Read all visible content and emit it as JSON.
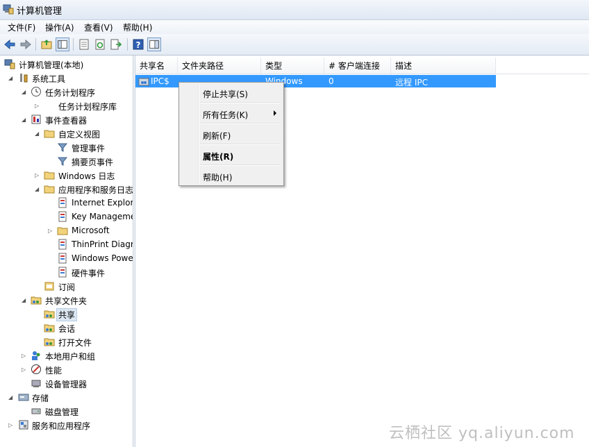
{
  "window": {
    "title": "计算机管理"
  },
  "menu": [
    "文件(F)",
    "操作(A)",
    "查看(V)",
    "帮助(H)"
  ],
  "toolbar": {
    "buttons": [
      "back-icon",
      "forward-icon",
      "up-folder-icon",
      "show-hide-console-tree-icon",
      "properties-icon",
      "refresh-icon",
      "export-list-icon",
      "help-icon",
      "show-hide-action-pane-icon"
    ]
  },
  "tree": {
    "nodes": [
      {
        "label": "计算机管理(本地)",
        "icon": "computer-management-icon"
      },
      {
        "label": "系统工具",
        "icon": "tools-icon"
      },
      {
        "label": "任务计划程序",
        "icon": "clock-icon"
      },
      {
        "label": "任务计划程序库",
        "icon": ""
      },
      {
        "label": "事件查看器",
        "icon": "event-viewer-icon"
      },
      {
        "label": "自定义视图",
        "icon": "folder-icon"
      },
      {
        "label": "管理事件",
        "icon": "filter-icon"
      },
      {
        "label": "摘要页事件",
        "icon": "filter-icon"
      },
      {
        "label": "Windows 日志",
        "icon": "folder-icon"
      },
      {
        "label": "应用程序和服务日志",
        "icon": "folder-icon"
      },
      {
        "label": "Internet Explor",
        "icon": "log-icon"
      },
      {
        "label": "Key Manageme",
        "icon": "log-icon"
      },
      {
        "label": "Microsoft",
        "icon": "folder-icon"
      },
      {
        "label": "ThinPrint Diagr",
        "icon": "log-icon"
      },
      {
        "label": "Windows Powe",
        "icon": "log-icon"
      },
      {
        "label": "硬件事件",
        "icon": "log-icon"
      },
      {
        "label": "订阅",
        "icon": "subscription-icon"
      },
      {
        "label": "共享文件夹",
        "icon": "shared-folder-icon"
      },
      {
        "label": "共享",
        "icon": "shared-folder-icon"
      },
      {
        "label": "会话",
        "icon": "shared-folder-icon"
      },
      {
        "label": "打开文件",
        "icon": "shared-folder-icon"
      },
      {
        "label": "本地用户和组",
        "icon": "users-icon"
      },
      {
        "label": "性能",
        "icon": "performance-icon"
      },
      {
        "label": "设备管理器",
        "icon": "device-manager-icon"
      },
      {
        "label": "存储",
        "icon": "storage-icon"
      },
      {
        "label": "磁盘管理",
        "icon": "disk-icon"
      },
      {
        "label": "服务和应用程序",
        "icon": "services-icon"
      }
    ]
  },
  "list": {
    "columns": [
      "共享名",
      "文件夹路径",
      "类型",
      "# 客户端连接",
      "描述"
    ],
    "rows": [
      {
        "name": "IPC$",
        "path": "",
        "type": "Windows",
        "connections": "0",
        "description": "远程 IPC"
      }
    ]
  },
  "context_menu": {
    "items": [
      "停止共享(S)",
      "所有任务(K)",
      "刷新(F)",
      "属性(R)",
      "帮助(H)"
    ]
  },
  "watermark": "云栖社区 yq.aliyun.com",
  "colors": {
    "selection": "#3399ff",
    "tree_selection": "#dde8f3",
    "menu_bg": "#f0f0f0"
  }
}
